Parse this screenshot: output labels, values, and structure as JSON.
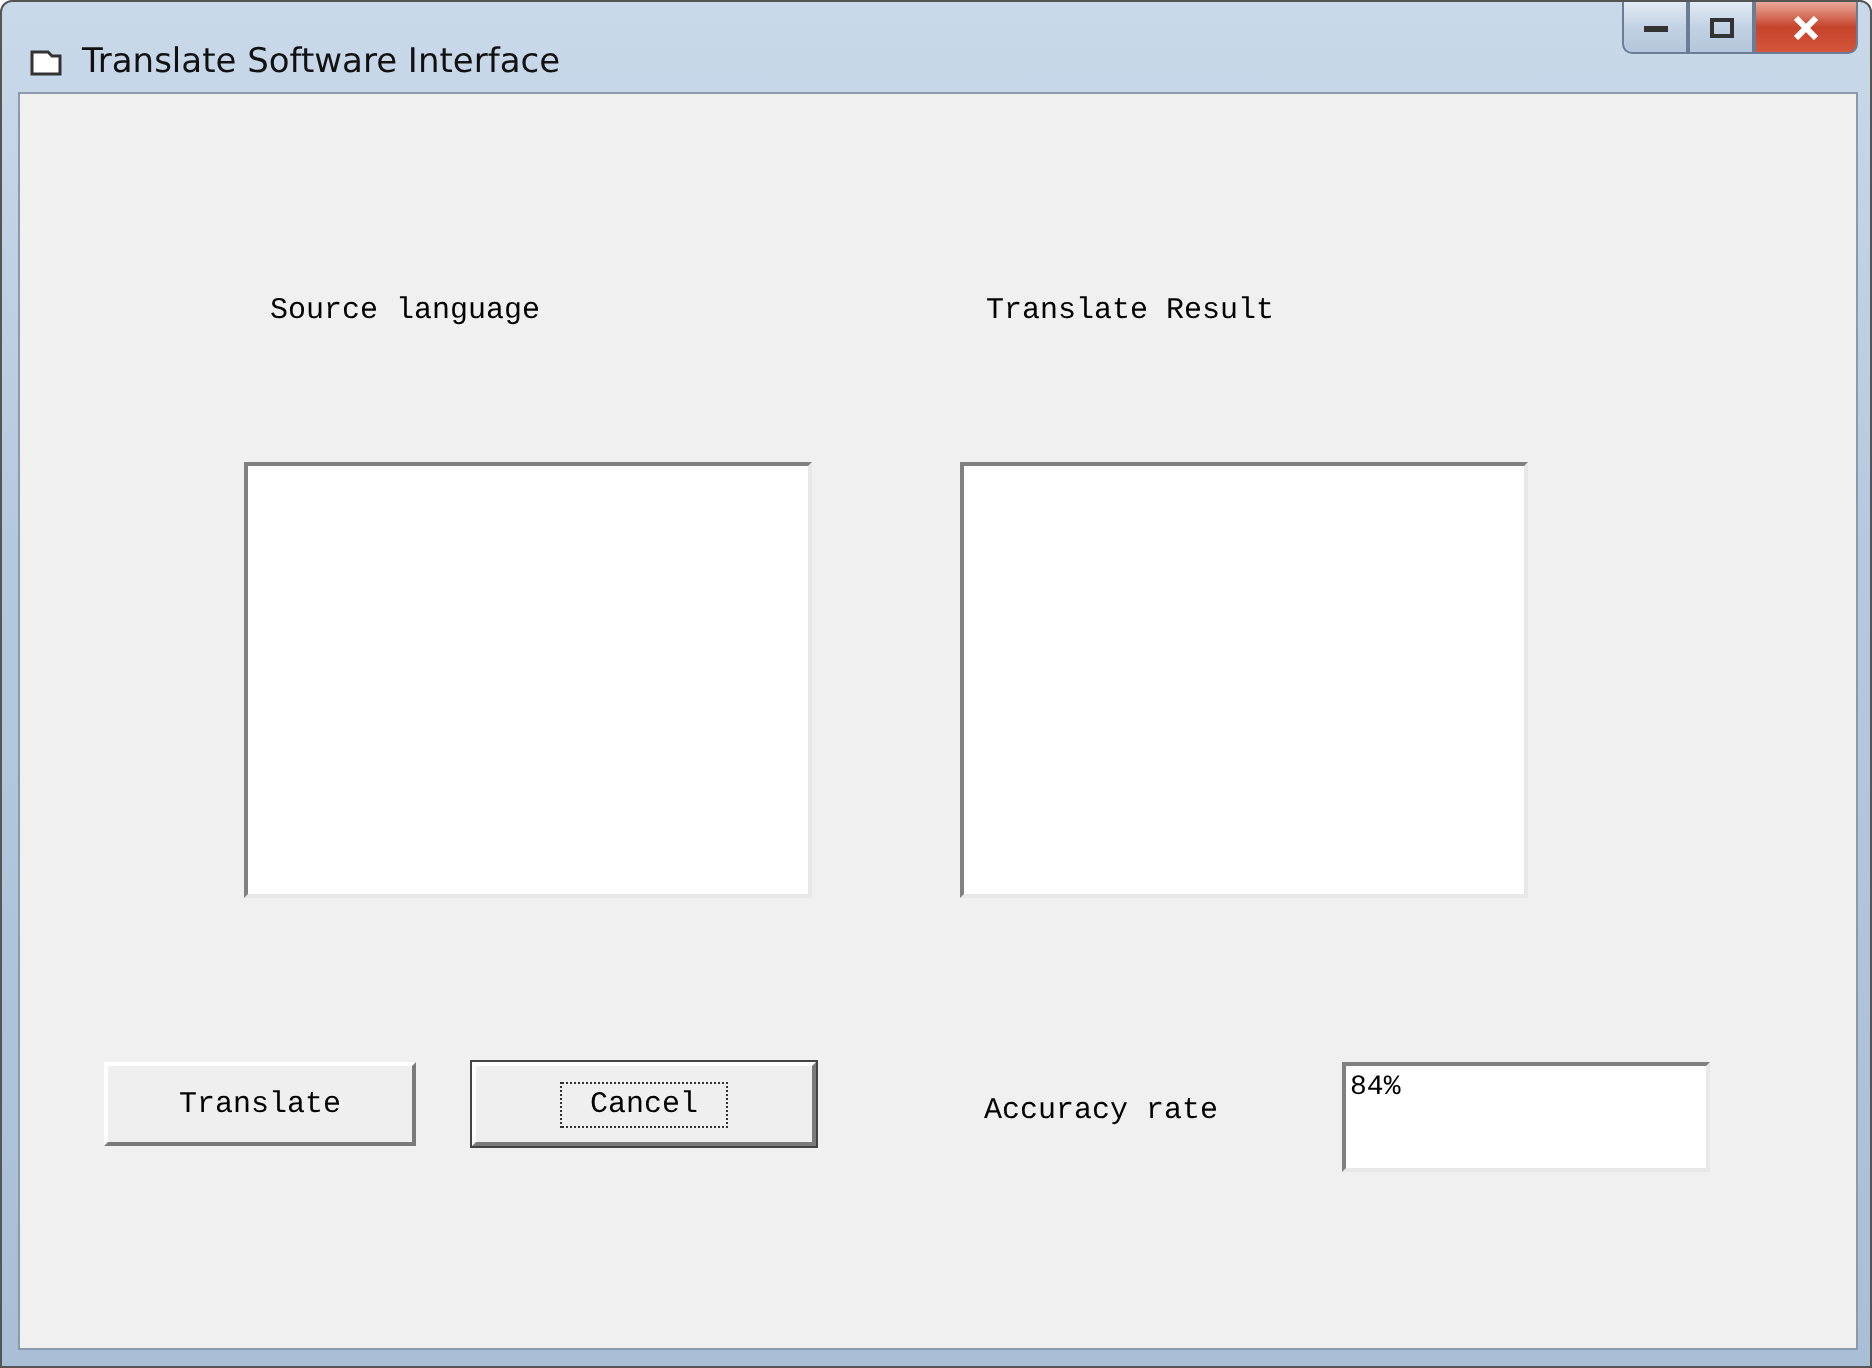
{
  "window": {
    "title": "Translate Software Interface"
  },
  "panes": [
    {
      "label": "Source language"
    },
    {
      "label": "Translate Result"
    }
  ],
  "buttons": [
    {
      "label": "Translate",
      "focused": false
    },
    {
      "label": "Cancel",
      "focused": true
    }
  ],
  "accuracy": {
    "label": "Accuracy rate",
    "value": "84%"
  }
}
